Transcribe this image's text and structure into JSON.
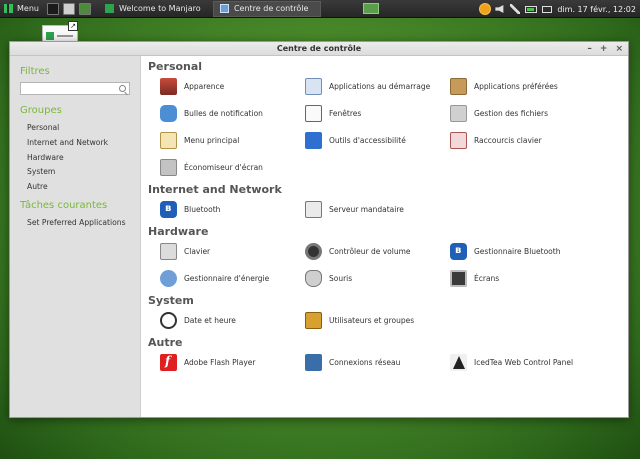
{
  "taskbar": {
    "menu_label": "Menu",
    "tasks": [
      {
        "label": "Welcome to Manjaro"
      },
      {
        "label": "Centre de contrôle"
      }
    ],
    "clock": "dim. 17 févr., 12:02"
  },
  "window": {
    "title": "Centre de contrôle",
    "buttons": {
      "minimize": "–",
      "maximize": "+",
      "close": "×"
    }
  },
  "sidebar": {
    "filter_heading": "Filtres",
    "filter_value": "",
    "groups_heading": "Groupes",
    "groups": [
      "Personal",
      "Internet and Network",
      "Hardware",
      "System",
      "Autre"
    ],
    "tasks_heading": "Tâches courantes",
    "tasks": [
      "Set Preferred Applications"
    ]
  },
  "sections": [
    {
      "title": "Personal",
      "items": [
        {
          "label": "Apparence",
          "icon": "appearance-icon"
        },
        {
          "label": "Applications au démarrage",
          "icon": "startup-applications-icon"
        },
        {
          "label": "Applications préférées",
          "icon": "preferred-applications-icon"
        },
        {
          "label": "Bulles de notification",
          "icon": "notification-icon"
        },
        {
          "label": "Fenêtres",
          "icon": "windows-icon"
        },
        {
          "label": "Gestion des fichiers",
          "icon": "file-management-icon"
        },
        {
          "label": "Menu principal",
          "icon": "main-menu-icon"
        },
        {
          "label": "Outils d'accessibilité",
          "icon": "accessibility-icon"
        },
        {
          "label": "Raccourcis clavier",
          "icon": "keyboard-shortcuts-icon"
        },
        {
          "label": "Économiseur d'écran",
          "icon": "screensaver-icon"
        }
      ]
    },
    {
      "title": "Internet and Network",
      "items": [
        {
          "label": "Bluetooth",
          "icon": "bluetooth-icon"
        },
        {
          "label": "Serveur mandataire",
          "icon": "proxy-icon"
        }
      ]
    },
    {
      "title": "Hardware",
      "items": [
        {
          "label": "Clavier",
          "icon": "keyboard-icon"
        },
        {
          "label": "Contrôleur de volume",
          "icon": "volume-icon"
        },
        {
          "label": "Gestionnaire Bluetooth",
          "icon": "bluetooth-icon"
        },
        {
          "label": "Gestionnaire d'énergie",
          "icon": "power-icon"
        },
        {
          "label": "Souris",
          "icon": "mouse-icon"
        },
        {
          "label": "Écrans",
          "icon": "screens-icon"
        }
      ]
    },
    {
      "title": "System",
      "items": [
        {
          "label": "Date et heure",
          "icon": "date-time-icon"
        },
        {
          "label": "Utilisateurs et groupes",
          "icon": "users-groups-icon"
        }
      ]
    },
    {
      "title": "Autre",
      "items": [
        {
          "label": "Adobe Flash Player",
          "icon": "flash-icon"
        },
        {
          "label": "Connexions réseau",
          "icon": "network-icon"
        },
        {
          "label": "IcedTea Web Control Panel",
          "icon": "icedtea-icon"
        }
      ]
    }
  ]
}
